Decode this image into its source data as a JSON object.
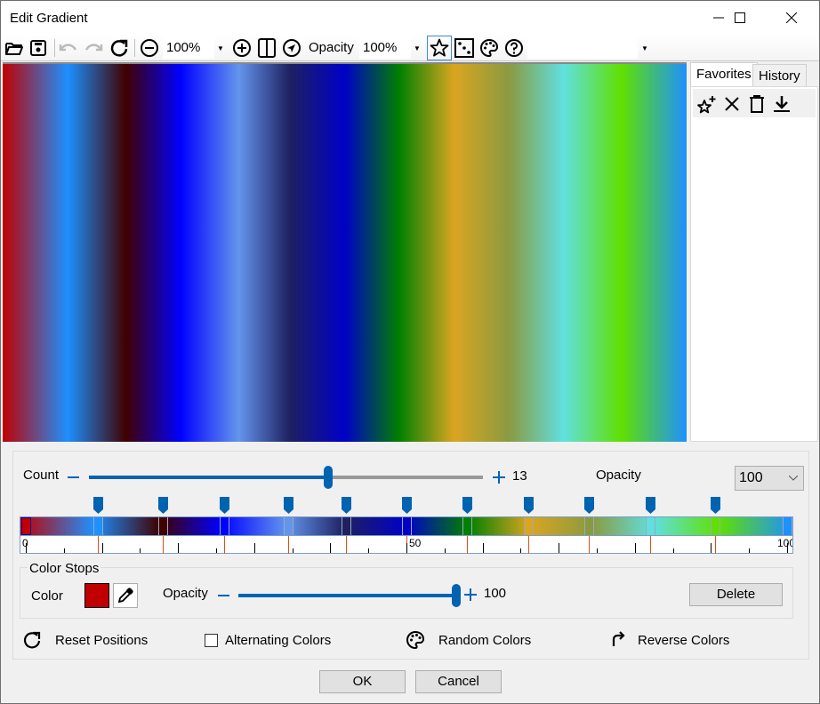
{
  "window": {
    "title": "Edit Gradient",
    "controls": [
      "minimize",
      "maximize",
      "close"
    ]
  },
  "toolbar": {
    "icons": [
      "open-folder-icon",
      "save-icon",
      "undo-icon",
      "redo-icon",
      "refresh-icon",
      "zoom-out-icon",
      "zoom-in-icon",
      "split-view-icon",
      "navigate-icon",
      "favorite-star-icon",
      "random-dots-icon",
      "palette-icon",
      "help-icon"
    ],
    "zoom_value": "100%",
    "opacity_label": "Opacity",
    "opacity_value": "100%",
    "extra_dropdown_value": ""
  },
  "side_panel": {
    "tabs": [
      {
        "label": "Favorites",
        "active": true
      },
      {
        "label": "History",
        "active": false
      }
    ],
    "favorite_tools": [
      "add-favorite-icon",
      "remove-icon",
      "delete-icon",
      "download-icon"
    ]
  },
  "gradient": {
    "stops": [
      {
        "position": 0,
        "color": "#c00000"
      },
      {
        "position": 9.5,
        "color": "#1e90ff"
      },
      {
        "position": 18,
        "color": "#400000"
      },
      {
        "position": 26,
        "color": "#0000ff"
      },
      {
        "position": 34.5,
        "color": "#6495ed"
      },
      {
        "position": 42,
        "color": "#1e2060"
      },
      {
        "position": 50,
        "color": "#0000c8"
      },
      {
        "position": 58,
        "color": "#008000"
      },
      {
        "position": 66,
        "color": "#daa520"
      },
      {
        "position": 74,
        "color": "#8a9a40"
      },
      {
        "position": 82,
        "color": "#60e0e0"
      },
      {
        "position": 90.5,
        "color": "#60e000"
      },
      {
        "position": 100,
        "color": "#1e90ff"
      }
    ]
  },
  "controls": {
    "count_label": "Count",
    "count_value": "13",
    "count_fraction": 0.61,
    "opacity_label": "Opacity",
    "opacity_select_value": "100",
    "ruler_labels": [
      "0",
      "50",
      "100"
    ]
  },
  "color_stops": {
    "group_label": "Color Stops",
    "color_label": "Color",
    "selected_color": "#c00000",
    "opacity_label": "Opacity",
    "opacity_value": "100",
    "opacity_fraction": 1.0,
    "delete_label": "Delete"
  },
  "actions": {
    "reset_positions": "Reset Positions",
    "alternating_colors": "Alternating Colors",
    "alternating_checked": false,
    "random_colors": "Random Colors",
    "reverse_colors": "Reverse Colors"
  },
  "footer": {
    "ok_label": "OK",
    "cancel_label": "Cancel"
  }
}
